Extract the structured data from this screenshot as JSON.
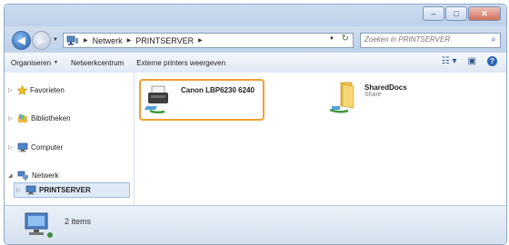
{
  "window": {
    "minimize_glyph": "–",
    "maximize_glyph": "□",
    "close_glyph": "✕"
  },
  "address": {
    "breadcrumbs": [
      "Netwerk",
      "PRINTSERVER"
    ],
    "back_glyph": "◀",
    "forward_glyph": "▶",
    "search_placeholder": "Zoeken in PRINTSERVER"
  },
  "toolbar": {
    "organize_label": "Organiseren",
    "network_center_label": "Netwerkcentrum",
    "external_printers_label": "Externe printers weergeven"
  },
  "navpane": {
    "items": [
      {
        "label": "Favorieten",
        "icon": "star-icon"
      },
      {
        "label": "Bibliotheken",
        "icon": "libraries-icon"
      },
      {
        "label": "Computer",
        "icon": "computer-icon"
      },
      {
        "label": "Netwerk",
        "icon": "network-icon"
      },
      {
        "label": "PRINTSERVER",
        "icon": "server-icon"
      }
    ]
  },
  "content": {
    "items": [
      {
        "name": "Canon LBP6230 6240",
        "subtitle": "",
        "icon": "printer-icon"
      },
      {
        "name": "SharedDocs",
        "subtitle": "Share",
        "icon": "shared-folder-icon"
      }
    ]
  },
  "status": {
    "count": "2 items"
  },
  "colors": {
    "selection_outline": "#f0a030",
    "window_frame": "#bcd0ea"
  }
}
